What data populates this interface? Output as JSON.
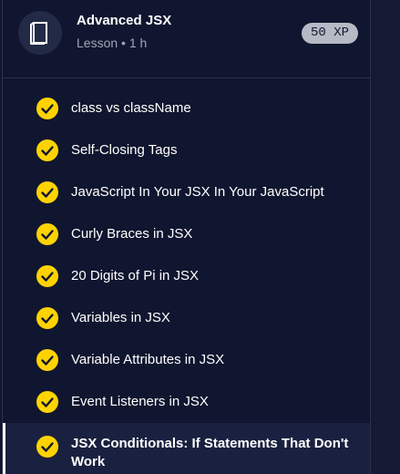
{
  "lesson": {
    "title": "Advanced JSX",
    "meta": "Lesson • 1 h",
    "xp": "50 XP",
    "icon": "book-icon"
  },
  "colors": {
    "background": "#10162f",
    "check_fill": "#ffd300",
    "badge": "#b7bac4"
  },
  "items": [
    {
      "label": "class vs className",
      "completed": true
    },
    {
      "label": "Self-Closing Tags",
      "completed": true
    },
    {
      "label": "JavaScript In Your JSX In Your JavaScript",
      "completed": true
    },
    {
      "label": "Curly Braces in JSX",
      "completed": true
    },
    {
      "label": "20 Digits of Pi in JSX",
      "completed": true
    },
    {
      "label": "Variables in JSX",
      "completed": true
    },
    {
      "label": "Variable Attributes in JSX",
      "completed": true
    },
    {
      "label": "Event Listeners in JSX",
      "completed": true
    },
    {
      "label": "JSX Conditionals: If Statements That Don't Work",
      "completed": true,
      "active": true
    }
  ]
}
